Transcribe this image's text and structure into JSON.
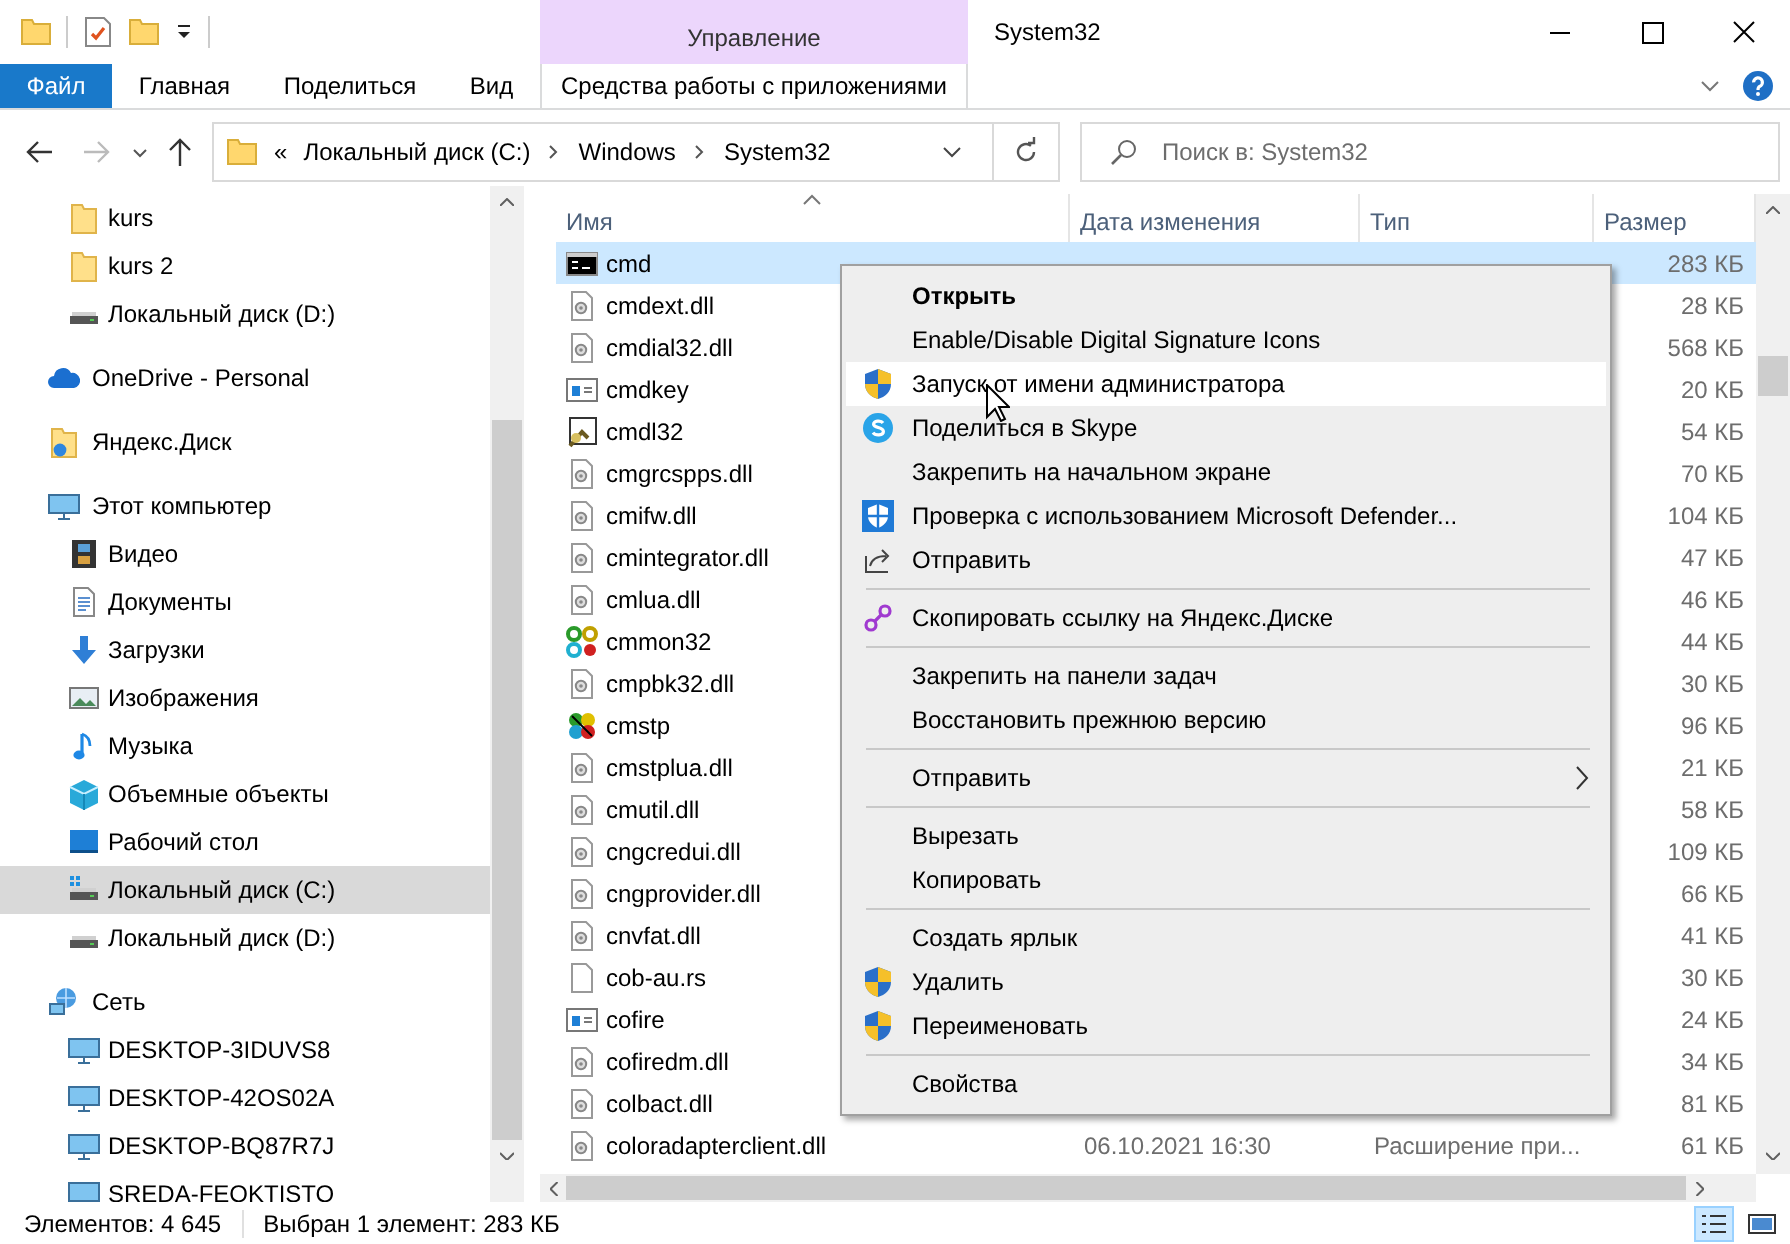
{
  "window": {
    "title": "System32"
  },
  "ribbon": {
    "context_group": "Управление",
    "tabs": [
      {
        "label": "Файл",
        "kind": "file"
      },
      {
        "label": "Главная",
        "kind": "normal"
      },
      {
        "label": "Поделиться",
        "kind": "normal"
      },
      {
        "label": "Вид",
        "kind": "normal"
      },
      {
        "label": "Средства работы с приложениями",
        "kind": "contextual"
      }
    ]
  },
  "address": {
    "overflow": "«",
    "path": [
      "Локальный диск (C:)",
      "Windows",
      "System32"
    ]
  },
  "search": {
    "placeholder": "Поиск в: System32"
  },
  "nav": {
    "top_items": [
      {
        "label": "kurs",
        "kind": "folder",
        "selected": false
      },
      {
        "label": "kurs 2",
        "kind": "folder",
        "selected": false
      },
      {
        "label": "Локальный диск (D:)",
        "kind": "drive",
        "selected": false
      }
    ],
    "items": [
      {
        "label": "OneDrive - Personal",
        "kind": "cloud",
        "selected": false
      },
      {
        "label": "Яндекс.Диск",
        "kind": "yandex",
        "selected": false
      },
      {
        "label": "Этот компьютер",
        "kind": "computer",
        "selected": false,
        "children": [
          {
            "label": "Видео",
            "kind": "video",
            "selected": false
          },
          {
            "label": "Документы",
            "kind": "documents",
            "selected": false
          },
          {
            "label": "Загрузки",
            "kind": "downloads",
            "selected": false
          },
          {
            "label": "Изображения",
            "kind": "pictures",
            "selected": false
          },
          {
            "label": "Музыка",
            "kind": "music",
            "selected": false
          },
          {
            "label": "Объемные объекты",
            "kind": "objects",
            "selected": false
          },
          {
            "label": "Рабочий стол",
            "kind": "desktop",
            "selected": false
          },
          {
            "label": "Локальный диск (C:)",
            "kind": "drive_windows",
            "selected": true
          },
          {
            "label": "Локальный диск (D:)",
            "kind": "drive",
            "selected": false
          }
        ]
      },
      {
        "label": "Сеть",
        "kind": "network",
        "selected": false,
        "children": [
          {
            "label": "DESKTOP-3IDUVS8",
            "kind": "pc",
            "selected": false
          },
          {
            "label": "DESKTOP-42OS02A",
            "kind": "pc",
            "selected": false
          },
          {
            "label": "DESKTOP-BQ87R7J",
            "kind": "pc",
            "selected": false
          },
          {
            "label": "SREDA-FEOKTISTO",
            "kind": "pc",
            "selected": false
          }
        ]
      }
    ]
  },
  "columns": [
    {
      "label": "Имя",
      "sorted": true
    },
    {
      "label": "Дата изменения",
      "sorted": false
    },
    {
      "label": "Тип",
      "sorted": false
    },
    {
      "label": "Размер",
      "sorted": false
    }
  ],
  "files": [
    {
      "name": "cmd",
      "kind": "cmd",
      "size": "283 КБ",
      "selected": true
    },
    {
      "name": "cmdext.dll",
      "kind": "dll",
      "size": "28 КБ",
      "selected": false
    },
    {
      "name": "cmdial32.dll",
      "kind": "dll",
      "size": "568 КБ",
      "selected": false
    },
    {
      "name": "cmdkey",
      "kind": "window",
      "size": "20 КБ",
      "selected": false
    },
    {
      "name": "cmdl32",
      "kind": "cmdl",
      "size": "54 КБ",
      "selected": false
    },
    {
      "name": "cmgrcspps.dll",
      "kind": "dll",
      "size": "70 КБ",
      "selected": false
    },
    {
      "name": "cmifw.dll",
      "kind": "dll",
      "size": "104 КБ",
      "selected": false
    },
    {
      "name": "cmintegrator.dll",
      "kind": "dll",
      "size": "47 КБ",
      "selected": false
    },
    {
      "name": "cmlua.dll",
      "kind": "dll",
      "size": "46 КБ",
      "selected": false
    },
    {
      "name": "cmmon32",
      "kind": "cmmon",
      "size": "44 КБ",
      "selected": false
    },
    {
      "name": "cmpbk32.dll",
      "kind": "dll",
      "size": "30 КБ",
      "selected": false
    },
    {
      "name": "cmstp",
      "kind": "cmstp",
      "size": "96 КБ",
      "selected": false
    },
    {
      "name": "cmstplua.dll",
      "kind": "dll",
      "size": "21 КБ",
      "selected": false
    },
    {
      "name": "cmutil.dll",
      "kind": "dll",
      "size": "58 КБ",
      "selected": false
    },
    {
      "name": "cngcredui.dll",
      "kind": "dll",
      "size": "109 КБ",
      "selected": false
    },
    {
      "name": "cngprovider.dll",
      "kind": "dll",
      "size": "66 КБ",
      "selected": false
    },
    {
      "name": "cnvfat.dll",
      "kind": "dll",
      "size": "41 КБ",
      "selected": false
    },
    {
      "name": "cob-au.rs",
      "kind": "file",
      "size": "30 КБ",
      "selected": false
    },
    {
      "name": "cofire",
      "kind": "window",
      "size": "24 КБ",
      "selected": false
    },
    {
      "name": "cofiredm.dll",
      "kind": "dll",
      "size": "34 КБ",
      "selected": false
    },
    {
      "name": "colbact.dll",
      "kind": "dll",
      "size": "81 КБ",
      "selected": false
    },
    {
      "name": "coloradapterclient.dll",
      "kind": "dll",
      "date": "06.10.2021 16:30",
      "type": "Расширение при...",
      "size": "61 КБ",
      "selected": false
    }
  ],
  "context_menu": {
    "groups": [
      [
        {
          "label": "Открыть",
          "kind": "plain",
          "default": true,
          "hovered": false
        },
        {
          "label": "Enable/Disable Digital Signature Icons",
          "kind": "plain",
          "default": false,
          "hovered": false
        },
        {
          "label": "Запуск от имени администратора",
          "kind": "shield",
          "default": false,
          "hovered": true
        },
        {
          "label": "Поделиться в Skype",
          "kind": "skype",
          "default": false,
          "hovered": false
        },
        {
          "label": "Закрепить на начальном экране",
          "kind": "plain",
          "default": false,
          "hovered": false
        },
        {
          "label": "Проверка с использованием Microsoft Defender...",
          "kind": "defender",
          "default": false,
          "hovered": false
        },
        {
          "label": "Отправить",
          "kind": "share",
          "default": false,
          "hovered": false
        }
      ],
      [
        {
          "label": "Скопировать ссылку на Яндекс.Диске",
          "kind": "link",
          "default": false,
          "hovered": false
        }
      ],
      [
        {
          "label": "Закрепить на панели задач",
          "kind": "plain",
          "default": false,
          "hovered": false
        },
        {
          "label": "Восстановить прежнюю версию",
          "kind": "plain",
          "default": false,
          "hovered": false
        }
      ],
      [
        {
          "label": "Отправить",
          "kind": "submenu",
          "default": false,
          "hovered": false
        }
      ],
      [
        {
          "label": "Вырезать",
          "kind": "plain",
          "default": false,
          "hovered": false
        },
        {
          "label": "Копировать",
          "kind": "plain",
          "default": false,
          "hovered": false
        }
      ],
      [
        {
          "label": "Создать ярлык",
          "kind": "plain",
          "default": false,
          "hovered": false
        },
        {
          "label": "Удалить",
          "kind": "shield",
          "default": false,
          "hovered": false
        },
        {
          "label": "Переименовать",
          "kind": "shield",
          "default": false,
          "hovered": false
        }
      ],
      [
        {
          "label": "Свойства",
          "kind": "plain",
          "default": false,
          "hovered": false
        }
      ]
    ]
  },
  "status_bar": {
    "count": "Элементов: 4 645",
    "selection": "Выбран 1 элемент: 283 КБ",
    "views": [
      {
        "kind": "details",
        "selected": true
      },
      {
        "kind": "tiles",
        "selected": false
      }
    ]
  }
}
